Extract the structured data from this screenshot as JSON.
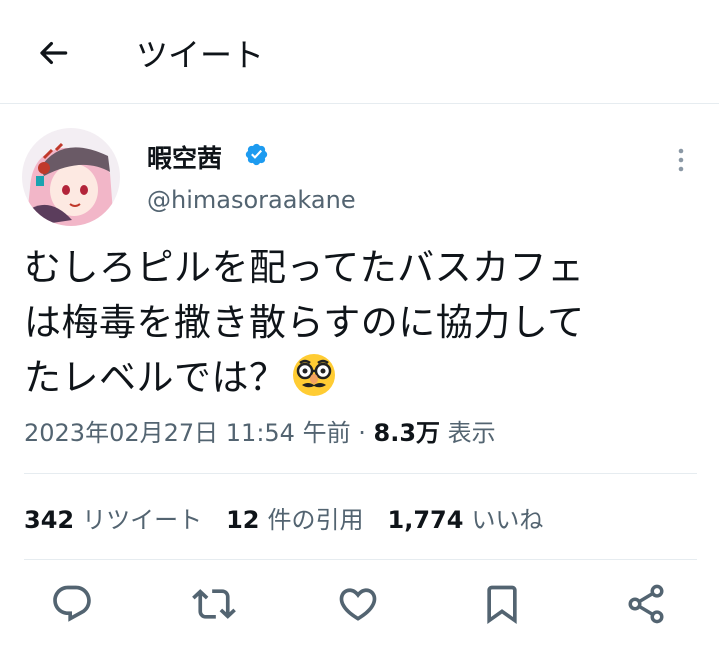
{
  "header": {
    "title": "ツイート",
    "back_icon": "arrow-left-icon"
  },
  "author": {
    "name": "暇空茜",
    "handle": "@himasoraakane",
    "verified": true,
    "verified_color": "#1d9bf0",
    "avatar_icon": "avatar"
  },
  "tweet": {
    "line1": "むしろピルを配ってたバスカフェ",
    "line2": "は梅毒を撒き散らすのに協力して",
    "line3": "たレベルでは？",
    "emoji_icon": "disguised-face-icon"
  },
  "meta": {
    "datetime": "2023年02月27日 11:54 午前",
    "separator": "·",
    "views_count": "8.3万",
    "views_label": "表示"
  },
  "stats": {
    "retweets_count": "342",
    "retweets_label": "リツイート",
    "quotes_count": "12",
    "quotes_label": "件の引用",
    "likes_count": "1,774",
    "likes_label": "いいね"
  },
  "actions": [
    "reply-icon",
    "retweet-icon",
    "like-icon",
    "bookmark-icon",
    "share-icon"
  ],
  "colors": {
    "text": "#0f1419",
    "secondary": "#536471",
    "divider": "#e6ecf0",
    "accent": "#1d9bf0"
  }
}
